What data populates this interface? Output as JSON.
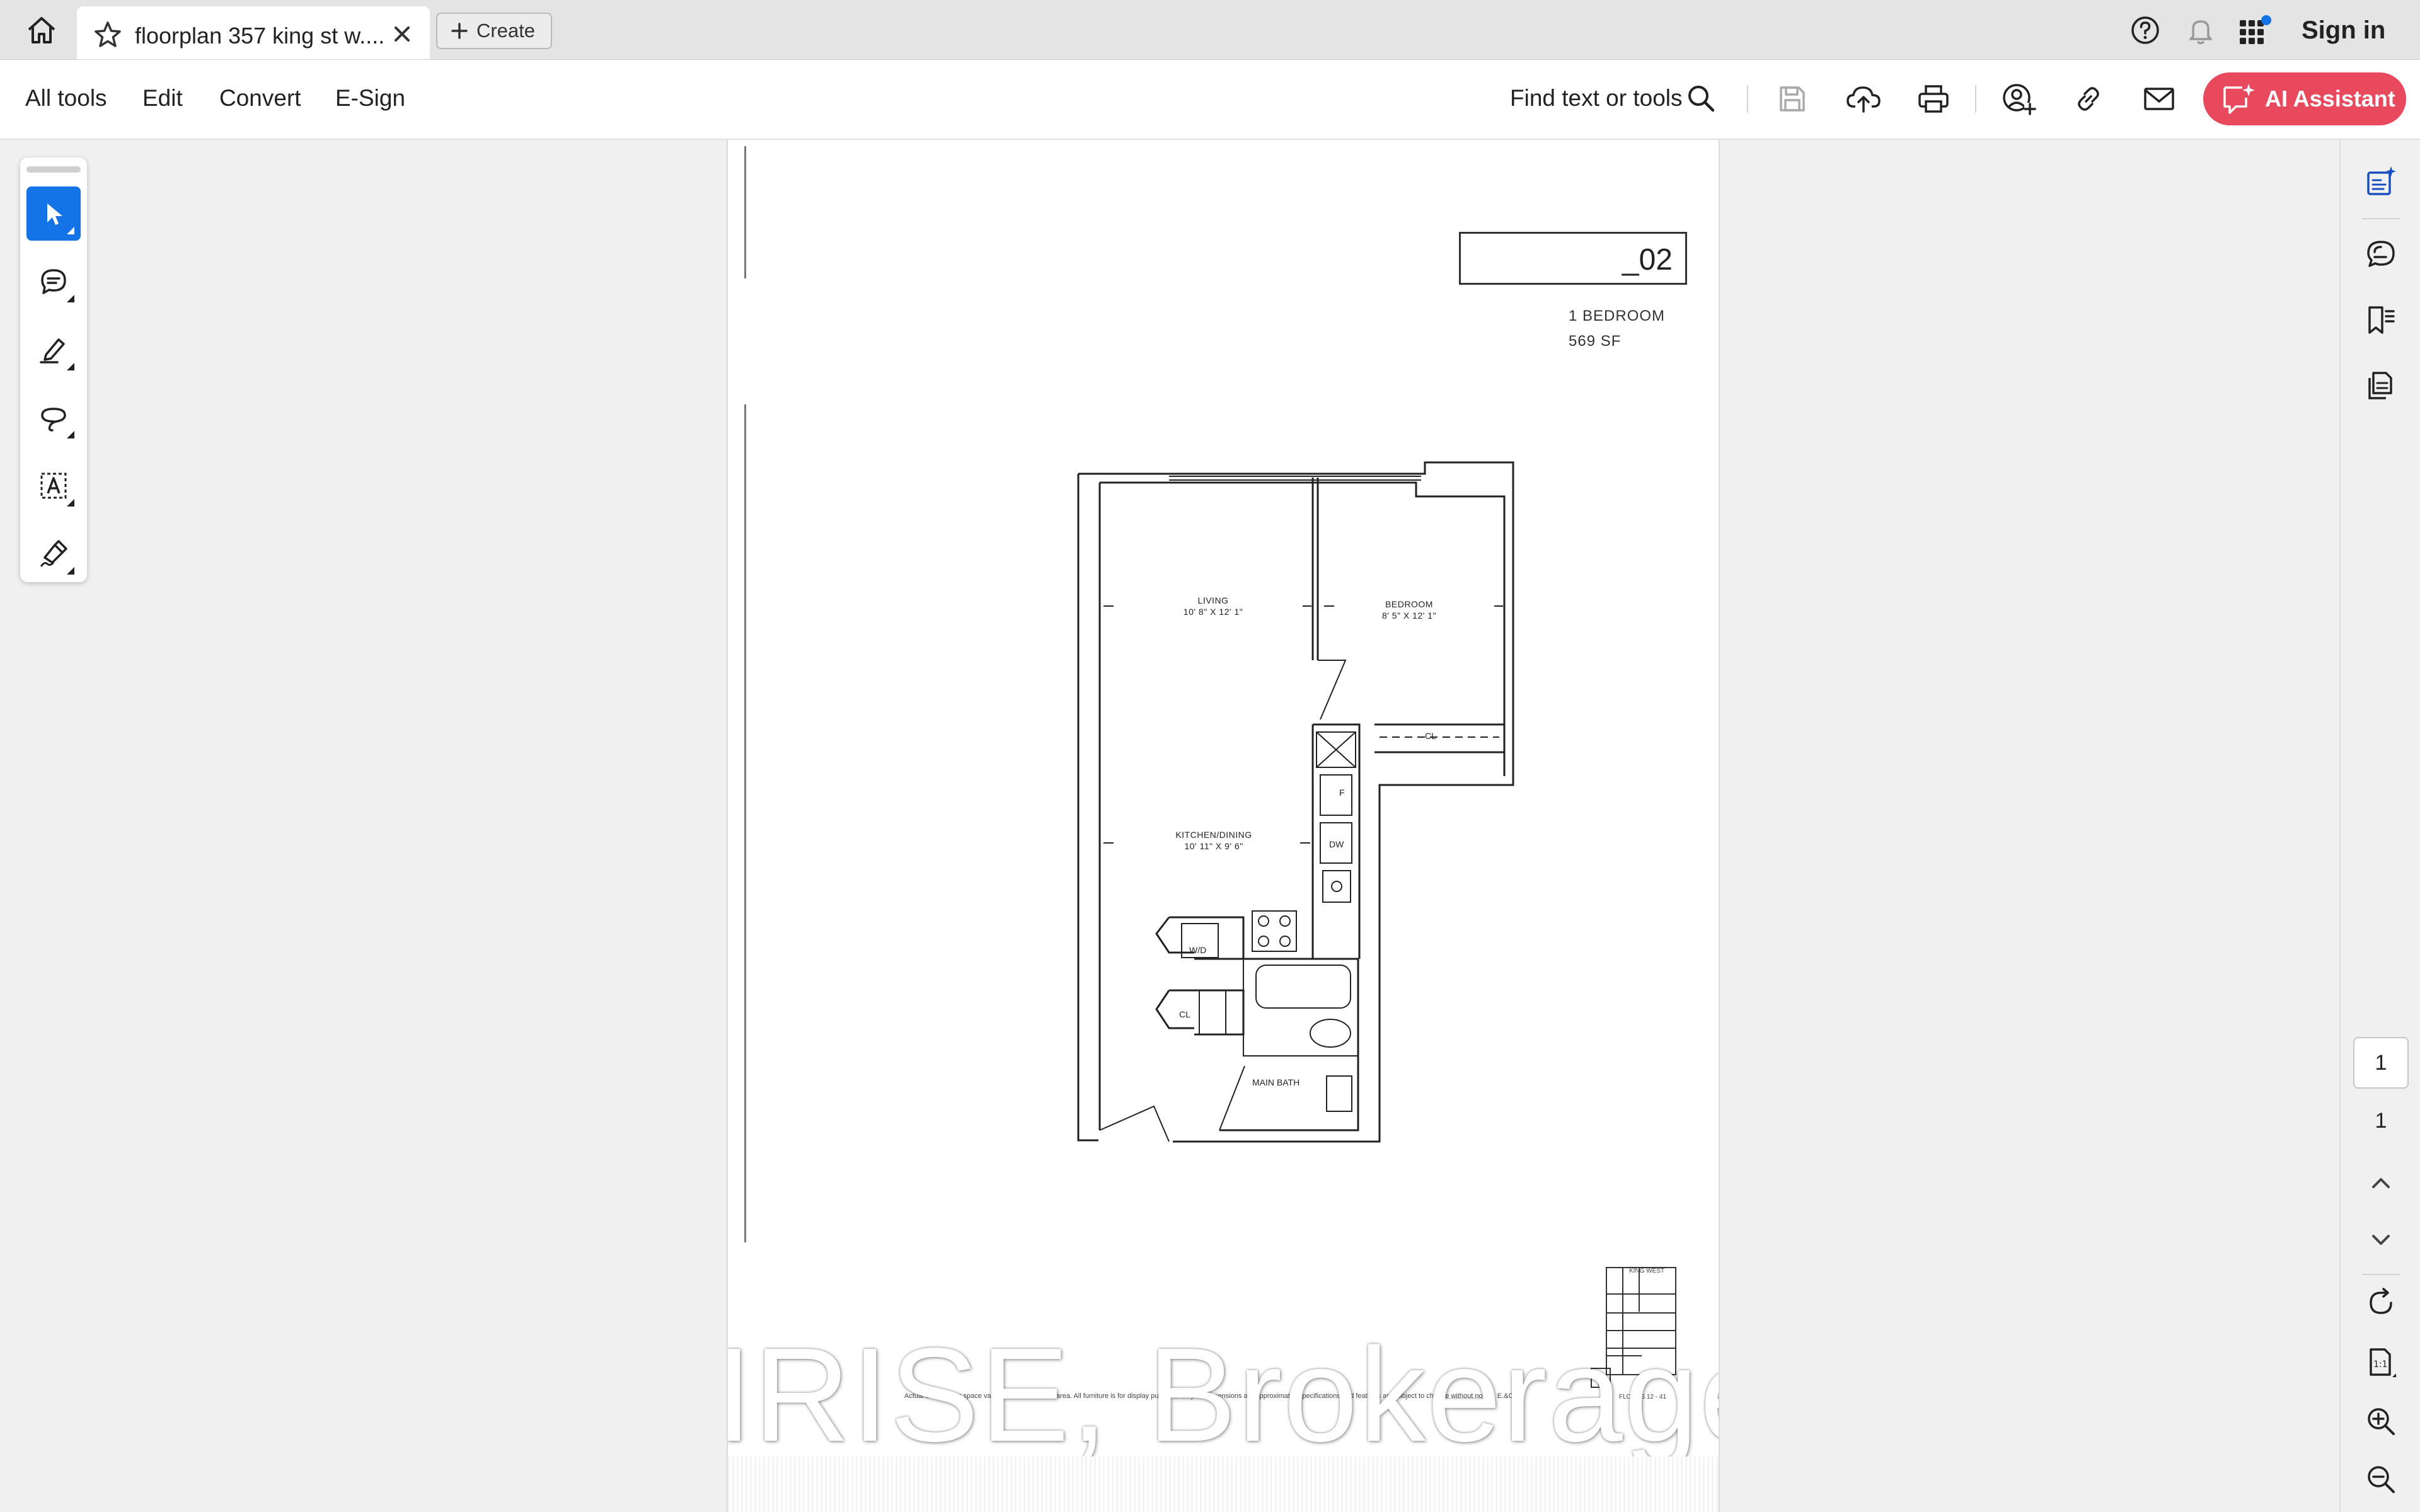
{
  "tabbar": {
    "tab_title": "floorplan 357 king st w....",
    "create_label": "Create",
    "sign_in": "Sign in"
  },
  "toolbar": {
    "menus": [
      "All tools",
      "Edit",
      "Convert",
      "E-Sign"
    ],
    "find_label": "Find text or tools",
    "ai_assistant_label": "AI Assistant"
  },
  "document": {
    "unit_number": "_02",
    "unit_type": "1 BEDROOM",
    "unit_size": "569 SF",
    "rooms": {
      "living_name": "LIVING",
      "living_dims": "10' 8\" X 12' 1\"",
      "bedroom_name": "BEDROOM",
      "bedroom_dims": "8' 5\" X 12' 1\"",
      "kitchen_name": "KITCHEN/DINING",
      "kitchen_dims": "10' 11\" X 9' 6\"",
      "main_bath": "MAIN BATH",
      "closet_1": "CL",
      "closet_2": "CL",
      "washer_dryer": "W/D",
      "dishwasher": "DW",
      "fridge": "F"
    },
    "watermark": "IRISE, Brokerage",
    "disclaimer": "Actual usable floor space varies from stated floor area. All furniture is for display purposes only. All dimensions are approximate. Specifications and features are subject to change without notice. E.&O.E.",
    "keyplan": {
      "street_top": "KING WEST",
      "floors": "FLOORS 12 - 41",
      "north": "N"
    }
  },
  "rightrail": {
    "current_page": "1",
    "total_pages": "1"
  },
  "colors": {
    "accent_blue": "#1473e6",
    "ai_button": "#e9495c",
    "notification_dot": "#1473e6"
  }
}
